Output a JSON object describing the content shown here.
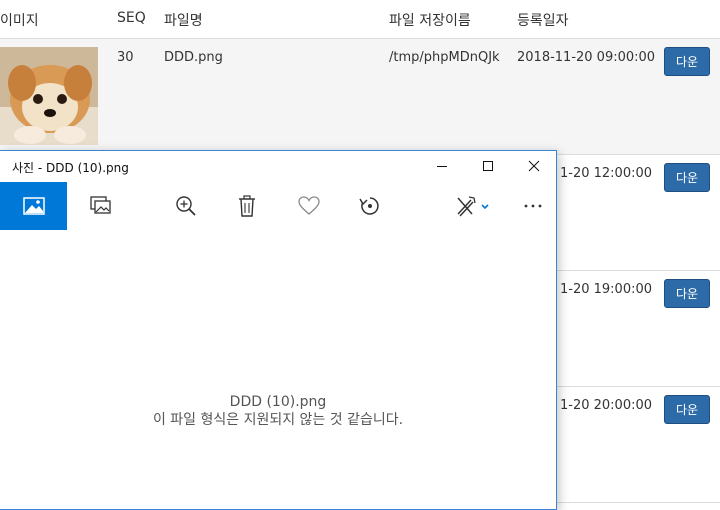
{
  "table": {
    "headers": [
      "이미지",
      "SEQ",
      "파일명",
      "파일 저장이름",
      "등록일자"
    ],
    "rows": [
      {
        "seq": "30",
        "filename": "DDD.png",
        "saved_name": "/tmp/phpMDnQJk",
        "date": "2018-11-20 09:00:00",
        "button": "다운"
      },
      {
        "date": "1-20 12:00:00",
        "button": "다운"
      },
      {
        "date": "1-20 19:00:00",
        "button": "다운"
      },
      {
        "date": "1-20 20:00:00",
        "button": "다운"
      }
    ]
  },
  "photos_window": {
    "title": "사진 - DDD (10).png",
    "toolbar_icons": [
      "image-view-icon",
      "collection-icon",
      "zoom-in-icon",
      "delete-icon",
      "favorite-heart-icon",
      "rotate-icon",
      "edit-draw-icon",
      "more-icon"
    ],
    "message_filename": "DDD (10).png",
    "message_text": "이 파일 형식은 지원되지 않는 것 같습니다."
  },
  "colors": {
    "accent": "#0078d7",
    "button": "#2c6aa8",
    "window_border": "#3a86d4",
    "row_shade": "#f5f5f5"
  }
}
